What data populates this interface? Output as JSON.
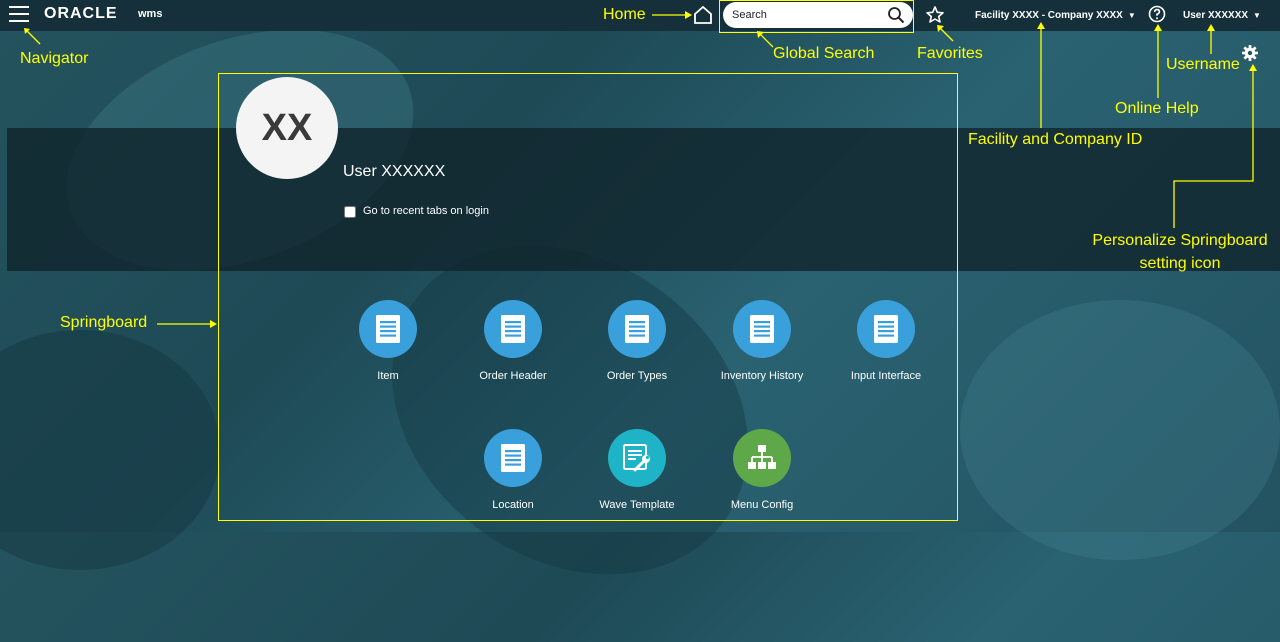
{
  "header": {
    "app_logo": "ORACLE",
    "app_name": "wms",
    "search_placeholder": "Search",
    "facility": "Facility XXXX - Company XXXX",
    "user": "User XXXXXX"
  },
  "profile": {
    "initials": "XX",
    "username": "User XXXXXX",
    "recent_tabs_label": "Go to recent tabs on login"
  },
  "tiles": [
    {
      "label": "Item",
      "icon": "document-icon",
      "color": "#3aa0dc"
    },
    {
      "label": "Order Header",
      "icon": "document-icon",
      "color": "#3aa0dc"
    },
    {
      "label": "Order Types",
      "icon": "document-icon",
      "color": "#3aa0dc"
    },
    {
      "label": "Inventory History",
      "icon": "document-icon",
      "color": "#3aa0dc"
    },
    {
      "label": "Input Interface",
      "icon": "document-icon",
      "color": "#3aa0dc"
    },
    {
      "label": "Location",
      "icon": "document-icon",
      "color": "#3aa0dc"
    },
    {
      "label": "Wave Template",
      "icon": "wrench-list-icon",
      "color": "#1fb3c8"
    },
    {
      "label": "Menu Config",
      "icon": "org-chart-icon",
      "color": "#5fa84a"
    }
  ],
  "annotations": {
    "navigator": "Navigator",
    "home": "Home",
    "global_search": "Global Search",
    "favorites": "Favorites",
    "facility_company": "Facility and Company ID",
    "online_help": "Online Help",
    "username": "Username",
    "personalize_line1": "Personalize Springboard",
    "personalize_line2": "setting icon",
    "springboard": "Springboard"
  },
  "colors": {
    "annotation": "#ffff00",
    "topbar": "#15303a",
    "background": "#24535e"
  }
}
